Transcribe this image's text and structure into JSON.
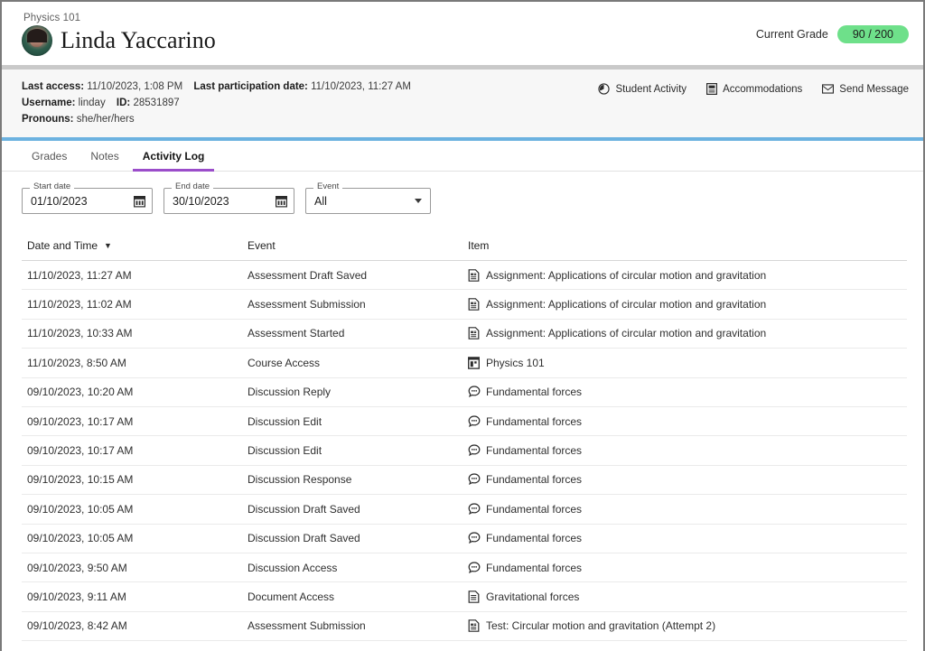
{
  "header": {
    "course_label": "Physics 101",
    "student_name": "Linda Yaccarino",
    "avatar_name": "student-avatar",
    "grade_label": "Current Grade",
    "grade_value": "90 / 200",
    "grade_color": "#6ee08a"
  },
  "info": {
    "last_access_label": "Last access:",
    "last_access_value": "11/10/2023, 1:08 PM",
    "last_participation_label": "Last participation date:",
    "last_participation_value": "11/10/2023, 11:27 AM",
    "username_label": "Username:",
    "username_value": "linday",
    "id_label": "ID:",
    "id_value": "28531897",
    "pronouns_label": "Pronouns:",
    "pronouns_value": "she/her/hers",
    "actions": [
      {
        "label": "Student Activity",
        "icon": "clock-icon"
      },
      {
        "label": "Accommodations",
        "icon": "book-icon"
      },
      {
        "label": "Send Message",
        "icon": "envelope-icon"
      }
    ]
  },
  "tabs": [
    {
      "label": "Grades",
      "active": false
    },
    {
      "label": "Notes",
      "active": false
    },
    {
      "label": "Activity Log",
      "active": true
    }
  ],
  "tab_accent": "#9b4dca",
  "filters": {
    "start_date": {
      "legend": "Start date",
      "value": "01/10/2023",
      "icon": "calendar-icon"
    },
    "end_date": {
      "legend": "End date",
      "value": "30/10/2023",
      "icon": "calendar-icon"
    },
    "event": {
      "legend": "Event",
      "value": "All",
      "icon": "chevron-down-icon"
    }
  },
  "table": {
    "columns": [
      "Date and Time",
      "Event",
      "Item"
    ],
    "sort_indicator": "▼",
    "rows": [
      {
        "date": "11/10/2023, 11:27 AM",
        "event": "Assessment Draft Saved",
        "item": "Assignment: Applications of circular motion and gravitation",
        "icon": "assignment-icon"
      },
      {
        "date": "11/10/2023, 11:02 AM",
        "event": "Assessment Submission",
        "item": "Assignment: Applications of circular motion and gravitation",
        "icon": "assignment-icon"
      },
      {
        "date": "11/10/2023, 10:33 AM",
        "event": "Assessment Started",
        "item": "Assignment: Applications of circular motion and gravitation",
        "icon": "assignment-icon"
      },
      {
        "date": "11/10/2023, 8:50 AM",
        "event": "Course Access",
        "item": "Physics 101",
        "icon": "course-icon"
      },
      {
        "date": "09/10/2023, 10:20 AM",
        "event": "Discussion Reply",
        "item": "Fundamental forces",
        "icon": "discussion-icon"
      },
      {
        "date": "09/10/2023, 10:17 AM",
        "event": "Discussion Edit",
        "item": "Fundamental forces",
        "icon": "discussion-icon"
      },
      {
        "date": "09/10/2023, 10:17 AM",
        "event": "Discussion Edit",
        "item": "Fundamental forces",
        "icon": "discussion-icon"
      },
      {
        "date": "09/10/2023, 10:15 AM",
        "event": "Discussion Response",
        "item": "Fundamental forces",
        "icon": "discussion-icon"
      },
      {
        "date": "09/10/2023, 10:05 AM",
        "event": "Discussion Draft Saved",
        "item": "Fundamental forces",
        "icon": "discussion-icon"
      },
      {
        "date": "09/10/2023, 10:05 AM",
        "event": "Discussion Draft Saved",
        "item": "Fundamental forces",
        "icon": "discussion-icon"
      },
      {
        "date": "09/10/2023, 9:50 AM",
        "event": "Discussion Access",
        "item": "Fundamental forces",
        "icon": "discussion-icon"
      },
      {
        "date": "09/10/2023, 9:11 AM",
        "event": "Document Access",
        "item": "Gravitational forces",
        "icon": "document-icon"
      },
      {
        "date": "09/10/2023, 8:42 AM",
        "event": "Assessment Submission",
        "item": "Test: Circular motion and gravitation (Attempt 2)",
        "icon": "assignment-icon"
      }
    ]
  }
}
